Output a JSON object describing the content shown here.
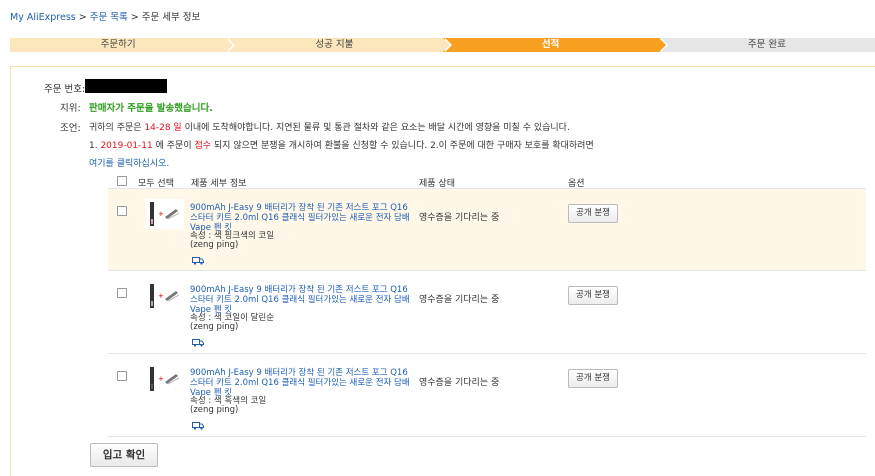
{
  "breadcrumb": {
    "home": "My AliExpress",
    "sep1": ">",
    "orders": "주문 목록",
    "sep2": ">",
    "current": "주문 세부 정보"
  },
  "steps": [
    {
      "label": "주문하기",
      "state": "done"
    },
    {
      "label": "성공 지불",
      "state": "done"
    },
    {
      "label": "선적",
      "state": "active"
    },
    {
      "label": "주문 완료",
      "state": "todo"
    }
  ],
  "order": {
    "number_label": "주문 번호:",
    "status_label": "지위:",
    "status_value": "판매자가 주문을 발송했습니다.",
    "advice_label": "조언:",
    "advice_pre": "귀하의 주문은 ",
    "advice_days": "14-28 일",
    "advice_post": " 이내에 도착해야합니다. 지연된 물류 및 통관 절차와 같은 요소는 배달 시간에 영향을 미칠 수 있습니다.",
    "advice2_pre": "1. ",
    "advice2_date": "2019-01-11",
    "advice2_mid": " 에 주문이 ",
    "advice2_receipt": "접수",
    "advice2_post": " 되지 않으면 분쟁을 개시하여 환불을 신청할 수 있습니다. 2.이 주문에 대한 구매자 보호를 확대하려면",
    "advice_link": "여기를 클릭하십시오."
  },
  "table": {
    "select_all": "모두 선택",
    "col_product": "제품 세부 정보",
    "col_status": "제품 상태",
    "col_options": "옵션"
  },
  "items": [
    {
      "name": "900mAh J-Easy 9 배터리가 장착 된 기존 저스트 포그 Q16 스타터 키트 2.0ml Q16 클래식 필터가있는 새로운 전자 담배 Vape 펜 킷",
      "attr_label": "속성 : 색 핑크색의 코일",
      "seller": "(zeng ping)",
      "status": "영수증을 기다리는 중",
      "action": "공개 분쟁",
      "truck_icon": "truck-icon"
    },
    {
      "name": "900mAh J-Easy 9 배터리가 장착 된 기존 저스트 포그 Q16 스타터 키트 2.0ml Q16 클래식 필터가있는 새로운 전자 담배 Vape 펜 킷",
      "attr_label": "속성 : 색 코일이 달린순",
      "seller": "(zeng ping)",
      "status": "영수증을 기다리는 중",
      "action": "공개 분쟁",
      "truck_icon": "truck-icon"
    },
    {
      "name": "900mAh J-Easy 9 배터리가 장착 된 기존 저스트 포그 Q16 스타터 키트 2.0ml Q16 클래식 필터가있는 새로운 전자 담배 Vape 펜 킷",
      "attr_label": "속성 : 색 흑색의 코일",
      "seller": "(zeng ping)",
      "status": "영수증을 기다리는 중",
      "action": "공개 분쟁",
      "truck_icon": "truck-icon"
    }
  ],
  "confirm_button": "입고 확인",
  "colors": {
    "link": "#1e5fb4",
    "status_green": "#2e9e1e",
    "accent_red": "#e4131c",
    "step_active": "#f7a020",
    "step_done": "#fbe7bb",
    "step_todo": "#e6e6e6",
    "row_highlight": "#fff7e8"
  }
}
